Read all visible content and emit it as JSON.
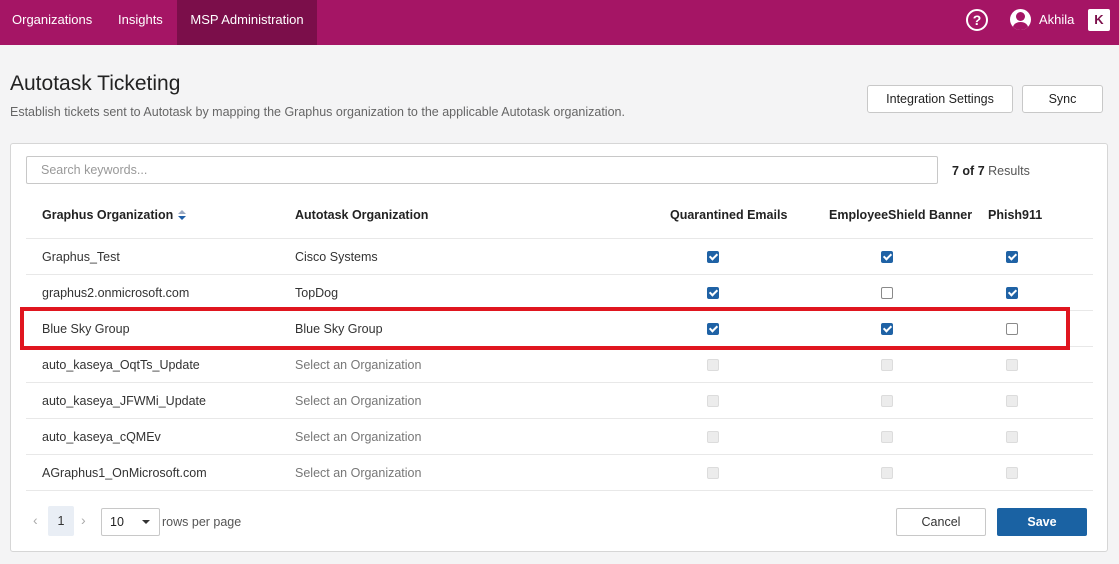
{
  "nav": {
    "items": [
      {
        "label": "Organizations",
        "active": false
      },
      {
        "label": "Insights",
        "active": false
      },
      {
        "label": "MSP Administration",
        "active": true
      }
    ],
    "help_symbol": "?",
    "user_name": "Akhila",
    "logo_text": "K"
  },
  "page": {
    "title": "Autotask Ticketing",
    "subtitle": "Establish tickets sent to Autotask by mapping the Graphus organization to the applicable Autotask organization."
  },
  "actions": {
    "integration_settings": "Integration Settings",
    "sync": "Sync"
  },
  "search": {
    "placeholder": "Search keywords...",
    "value": ""
  },
  "results": {
    "count": "7 of 7",
    "label": "Results"
  },
  "table": {
    "headers": {
      "graphus_org": "Graphus Organization",
      "autotask_org": "Autotask Organization",
      "quarantined": "Quarantined Emails",
      "banner": "EmployeeShield Banner",
      "phish": "Phish911"
    },
    "rows": [
      {
        "graphus": "Graphus_Test",
        "autotask": "Cisco Systems",
        "placeholder": false,
        "q": "on",
        "b": "on",
        "p": "on"
      },
      {
        "graphus": "graphus2.onmicrosoft.com",
        "autotask": "TopDog",
        "placeholder": false,
        "q": "on",
        "b": "off",
        "p": "on"
      },
      {
        "graphus": "Blue Sky Group",
        "autotask": "Blue Sky Group",
        "placeholder": false,
        "q": "on",
        "b": "on",
        "p": "off"
      },
      {
        "graphus": "auto_kaseya_OqtTs_Update",
        "autotask": "Select an Organization",
        "placeholder": true,
        "q": "disabled",
        "b": "disabled",
        "p": "disabled"
      },
      {
        "graphus": "auto_kaseya_JFWMi_Update",
        "autotask": "Select an Organization",
        "placeholder": true,
        "q": "disabled",
        "b": "disabled",
        "p": "disabled"
      },
      {
        "graphus": "auto_kaseya_cQMEv",
        "autotask": "Select an Organization",
        "placeholder": true,
        "q": "disabled",
        "b": "disabled",
        "p": "disabled"
      },
      {
        "graphus": "AGraphus1_OnMicrosoft.com",
        "autotask": "Select an Organization",
        "placeholder": true,
        "q": "disabled",
        "b": "disabled",
        "p": "disabled"
      }
    ]
  },
  "pagination": {
    "current_page": "1",
    "rows_per_page": "10",
    "rows_per_page_label": "rows per page"
  },
  "footer": {
    "cancel": "Cancel",
    "save": "Save"
  },
  "colors": {
    "nav_bg": "#a51565",
    "nav_active": "#7b0e4a",
    "primary": "#1a62a3",
    "highlight": "#e0161f"
  }
}
